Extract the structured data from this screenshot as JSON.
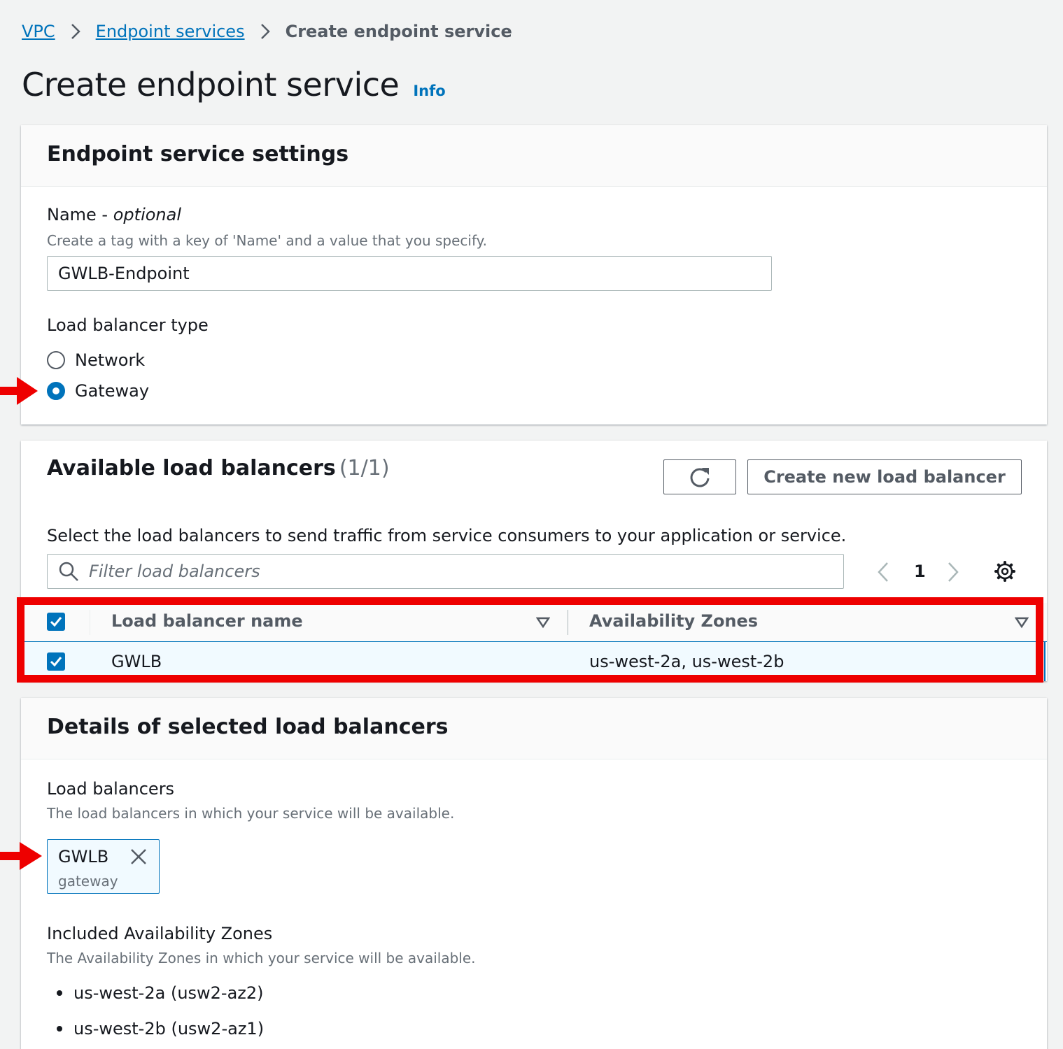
{
  "breadcrumb": {
    "items": [
      "VPC",
      "Endpoint services"
    ],
    "current": "Create endpoint service"
  },
  "page": {
    "title": "Create endpoint service",
    "info_link": "Info"
  },
  "settings": {
    "title": "Endpoint service settings",
    "name_label": "Name - ",
    "name_optional": "optional",
    "name_description": "Create a tag with a key of 'Name' and a value that you specify.",
    "name_value": "GWLB-Endpoint",
    "lb_type_label": "Load balancer type",
    "lb_type_options": [
      "Network",
      "Gateway"
    ],
    "lb_type_selected": "Gateway"
  },
  "available": {
    "title": "Available load balancers",
    "count": "(1/1)",
    "create_button": "Create new load balancer",
    "description": "Select the load balancers to send traffic from service consumers to your application or service.",
    "filter_placeholder": "Filter load balancers",
    "page_number": "1",
    "columns": [
      "Load balancer name",
      "Availability Zones"
    ],
    "rows": [
      {
        "name": "GWLB",
        "zones": "us-west-2a, us-west-2b",
        "selected": true
      }
    ]
  },
  "details": {
    "title": "Details of selected load balancers",
    "lb_label": "Load balancers",
    "lb_description": "The load balancers in which your service will be available.",
    "token_name": "GWLB",
    "token_type": "gateway",
    "az_label": "Included Availability Zones",
    "az_description": "The Availability Zones in which your service will be available.",
    "az_list": [
      "us-west-2a (usw2-az2)",
      "us-west-2b (usw2-az1)"
    ]
  },
  "colors": {
    "link": "#0073bb",
    "highlight_box": "#ee0000",
    "arrow": "#ee0000",
    "selected_row": "#f1faff"
  },
  "icons": [
    "chevron-right-icon",
    "refresh-icon",
    "search-icon",
    "chevron-left-icon",
    "gear-icon",
    "sort-down-icon",
    "checkmark-icon",
    "close-icon",
    "arrow-icon"
  ]
}
